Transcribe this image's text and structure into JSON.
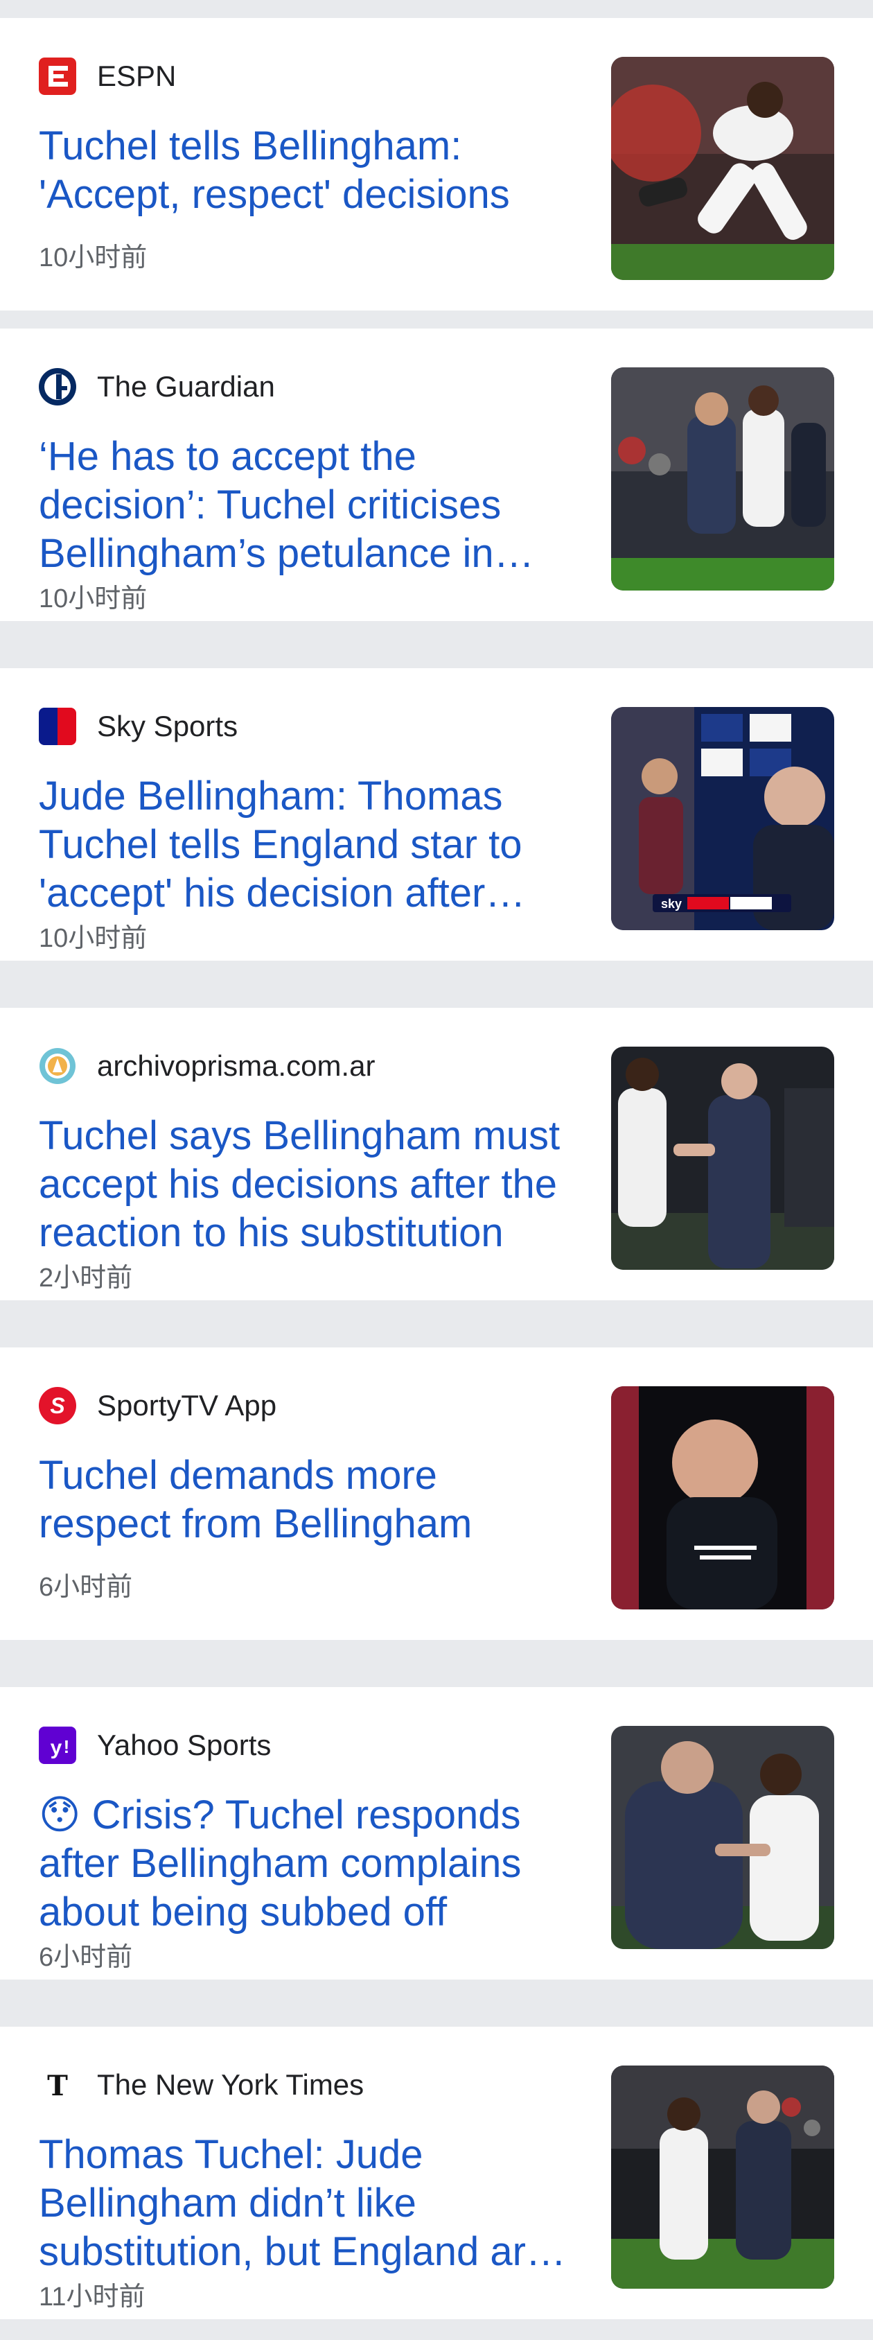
{
  "articles": [
    {
      "source": "ESPN",
      "source_icon": "espn-logo-icon",
      "title": "Tuchel tells Bellingham: 'Accept, respect' decisions",
      "time": "10小时前",
      "thumbnail": "bellingham-tackle-photo"
    },
    {
      "source": "The Guardian",
      "source_icon": "guardian-logo-icon",
      "title": "‘He has to accept the decision’: Tuchel criticises Bellingham’s petulance in England win",
      "time": "10小时前",
      "thumbnail": "tuchel-sideline-photo"
    },
    {
      "source": "Sky Sports",
      "source_icon": "sky-sports-logo-icon",
      "title": "Jude Bellingham: Thomas Tuchel tells England star to 'accept' his decision after substitution",
      "time": "10小时前",
      "thumbnail": "tuchel-press-conference-photo"
    },
    {
      "source": "archivoprisma.com.ar",
      "source_icon": "archivoprisma-logo-icon",
      "title": "Tuchel says Bellingham must accept his decisions after the reaction to his substitution",
      "time": "2小时前",
      "thumbnail": "bellingham-handshake-photo"
    },
    {
      "source": "SportyTV App",
      "source_icon": "sportytv-logo-icon",
      "title": "Tuchel demands more respect from Bellingham",
      "time": "6小时前",
      "thumbnail": "tuchel-video-still-photo"
    },
    {
      "source": "Yahoo Sports",
      "source_icon": "yahoo-logo-icon",
      "title": "😯 Crisis? Tuchel responds after Bellingham complains about being subbed off",
      "time": "6小时前",
      "thumbnail": "tuchel-bellingham-touchline-photo"
    },
    {
      "source": "The New York Times",
      "source_icon": "nyt-logo-icon",
      "title": "Thomas Tuchel: Jude Bellingham didn’t like substitution, but England are winning",
      "time": "11小时前",
      "thumbnail": "bellingham-substitution-photo"
    }
  ],
  "colors": {
    "title": "#1a57c5",
    "source": "#202124",
    "time": "#5f6368",
    "separator": "#e8eaed",
    "card": "#ffffff"
  }
}
